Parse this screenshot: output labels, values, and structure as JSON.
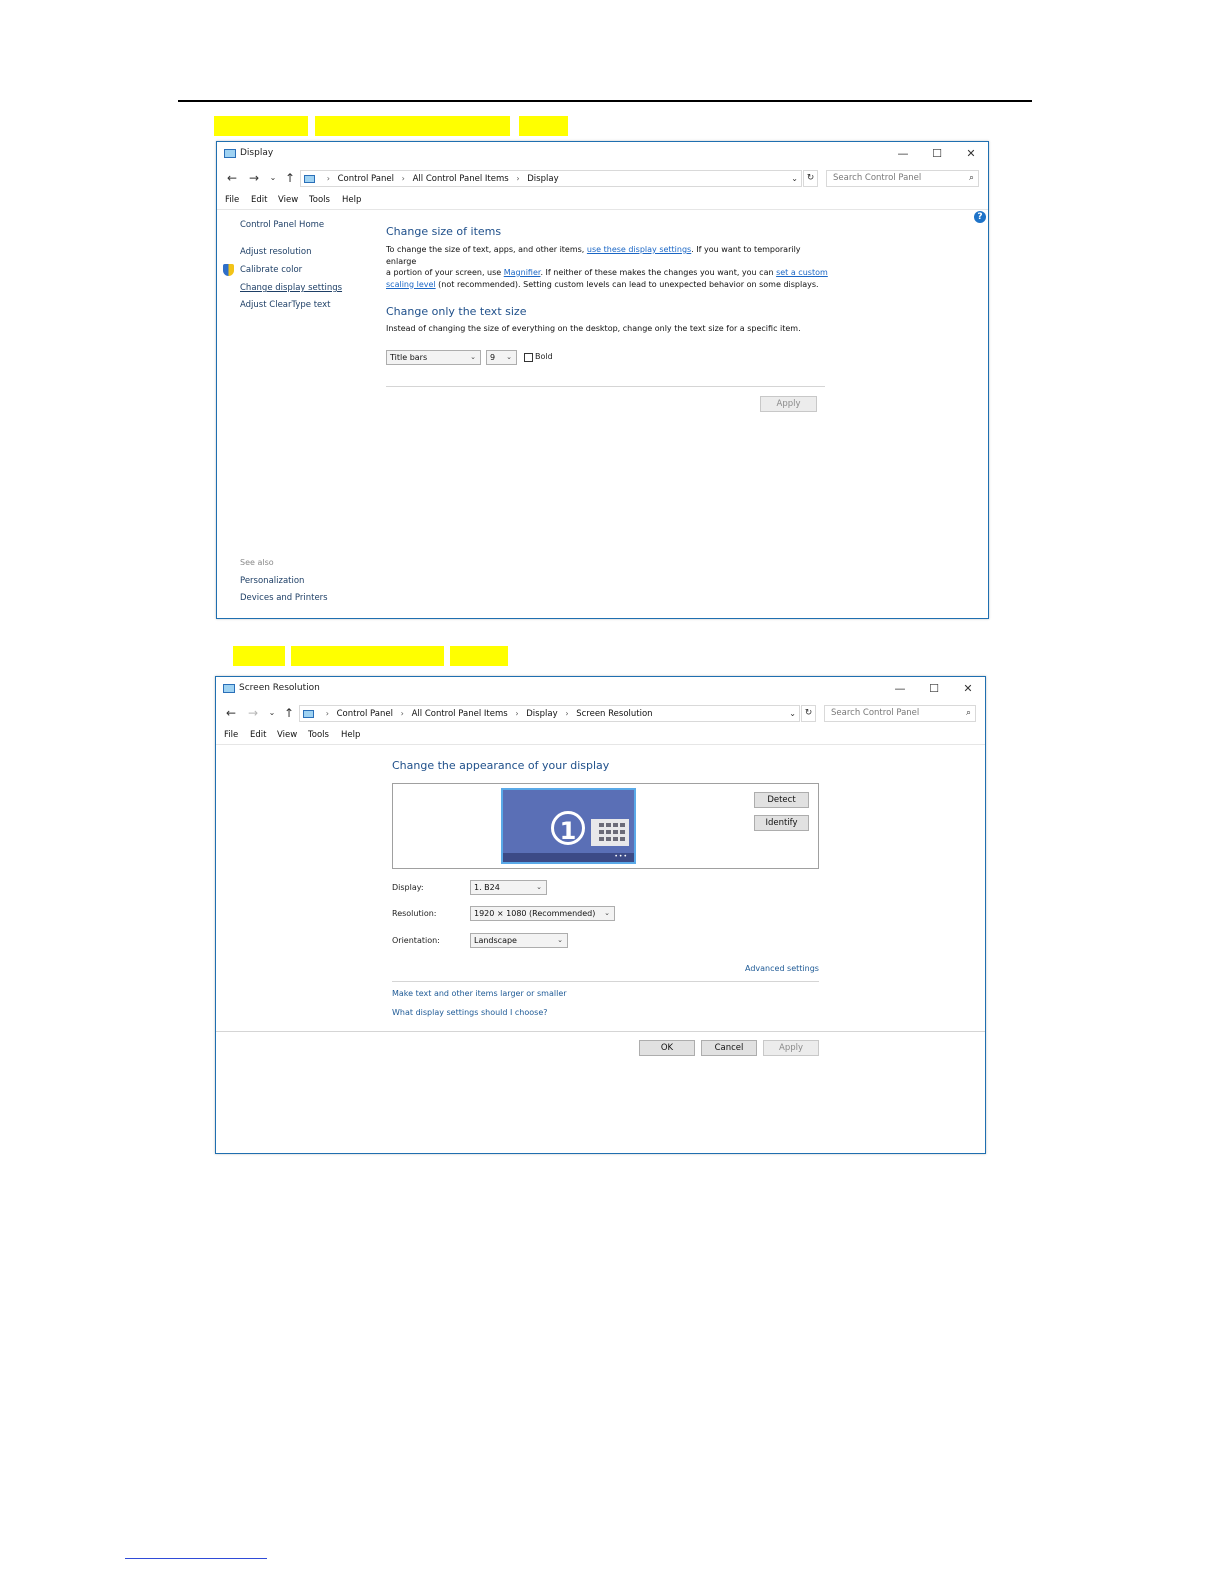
{
  "window1": {
    "title": "Display",
    "controls": {
      "minimize": "—",
      "maximize": "☐",
      "close": "✕"
    },
    "breadcrumb": [
      "Control Panel",
      "All Control Panel Items",
      "Display"
    ],
    "search_placeholder": "Search Control Panel",
    "menu": [
      "File",
      "Edit",
      "View",
      "Tools",
      "Help"
    ],
    "sidebar": {
      "home": "Control Panel Home",
      "items": [
        "Adjust resolution",
        "Calibrate color",
        "Change display settings",
        "Adjust ClearType text"
      ],
      "see_also_label": "See also",
      "see_also": [
        "Personalization",
        "Devices and Printers"
      ]
    },
    "section1": {
      "heading": "Change size of items",
      "p1": "To change the size of text, apps, and other items, ",
      "link1": "use these display settings",
      "p2": ". If you want to temporarily enlarge",
      "p3": "a portion of your screen, use ",
      "link2": "Magnifier",
      "p4": ". If neither of these makes the changes you want, you can ",
      "link3a": "set a custom",
      "link3b": "scaling level",
      "p5": " (not recommended). Setting custom levels can lead to unexpected behavior on some displays."
    },
    "section2": {
      "heading": "Change only the text size",
      "desc": "Instead of changing the size of everything on the desktop, change only the text size for a specific item.",
      "item_select": "Title bars",
      "size_select": "9",
      "bold_label": "Bold",
      "bold_checked": false,
      "apply": "Apply"
    }
  },
  "window2": {
    "title": "Screen Resolution",
    "controls": {
      "minimize": "—",
      "maximize": "☐",
      "close": "✕"
    },
    "breadcrumb": [
      "Control Panel",
      "All Control Panel Items",
      "Display",
      "Screen Resolution"
    ],
    "search_placeholder": "Search Control Panel",
    "menu": [
      "File",
      "Edit",
      "View",
      "Tools",
      "Help"
    ],
    "heading": "Change the appearance of your display",
    "monitor_number": "1",
    "detect": "Detect",
    "identify": "Identify",
    "fields": [
      {
        "label": "Display:",
        "value": "1. B24"
      },
      {
        "label": "Resolution:",
        "value": "1920 × 1080 (Recommended)"
      },
      {
        "label": "Orientation:",
        "value": "Landscape"
      }
    ],
    "advanced": "Advanced settings",
    "links": [
      "Make text and other items larger or smaller",
      "What display settings should I choose?"
    ],
    "buttons": {
      "ok": "OK",
      "cancel": "Cancel",
      "apply": "Apply"
    }
  },
  "colors": {
    "highlight": "#ffff00",
    "link": "#1a66c5",
    "heading": "#1e4f8a",
    "window_border": "#1f6fb0"
  },
  "icons": [
    "back-arrow-icon",
    "forward-arrow-icon",
    "recent-pages-icon",
    "up-arrow-icon",
    "refresh-icon",
    "search-icon",
    "help-icon",
    "shield-icon",
    "monitor-icon"
  ]
}
